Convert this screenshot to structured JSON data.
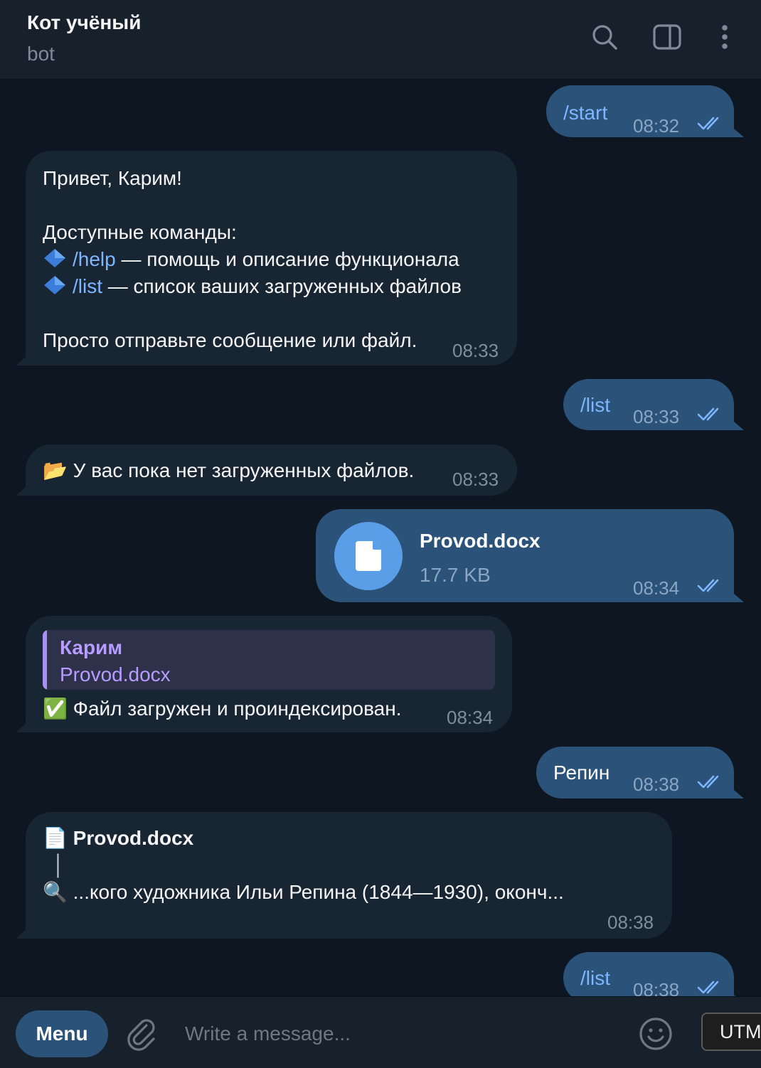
{
  "header": {
    "title": "Кот учёный",
    "subtitle": "bot",
    "icons": [
      "search-icon",
      "sidebar-toggle-icon",
      "more-vertical-icon"
    ]
  },
  "messages": {
    "m1": {
      "text": "/start",
      "time": "08:32"
    },
    "m2": {
      "greeting": "Привет, Карим!",
      "commands_title": "Доступные команды:",
      "cmd1": "/help",
      "cmd1_desc": " — помощь и описание функционала",
      "cmd2": "/list",
      "cmd2_desc": " — список ваших загруженных файлов",
      "footer": "Просто отправьте сообщение или файл.",
      "time": "08:33"
    },
    "m3": {
      "text": "/list",
      "time": "08:33"
    },
    "m4": {
      "emoji": "📂",
      "text": "У вас пока нет загруженных файлов.",
      "time": "08:33"
    },
    "m5": {
      "file_name": "Provod.docx",
      "file_size": "17.7 KB",
      "time": "08:34"
    },
    "m6": {
      "reply_name": "Карим",
      "reply_text": "Provod.docx",
      "emoji": "✅",
      "text": "Файл загружен и проиндексирован.",
      "time": "08:34"
    },
    "m7": {
      "text": "Репин",
      "time": "08:38"
    },
    "m8": {
      "file_emoji": "📄",
      "file_name": "Provod.docx",
      "connector": "│",
      "search_emoji": "🔍",
      "snippet": "...кого художника Ильи Репина (1844—1930), оконч...",
      "time": "08:38"
    },
    "m9": {
      "text": "/list",
      "time": "08:38"
    }
  },
  "bottom_bar": {
    "menu_label": "Menu",
    "input_placeholder": "Write a message...",
    "tooltip": "UTM"
  },
  "colors": {
    "background": "#0e1621",
    "header": "#17212b",
    "outgoing_bubble": "#2b5278",
    "incoming_bubble": "#182533",
    "link": "#7eb6ff",
    "reply_accent": "#a98ff5",
    "file_icon": "#5a9ee8"
  }
}
